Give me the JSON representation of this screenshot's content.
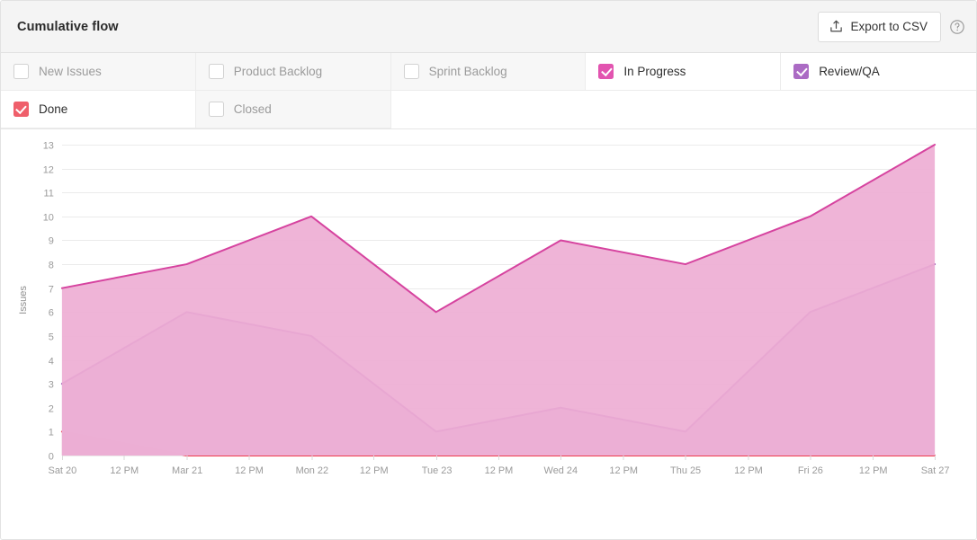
{
  "header": {
    "title": "Cumulative flow",
    "export_label": "Export to CSV",
    "export_icon": "upload-tray-icon",
    "help_icon": "help-circle-icon"
  },
  "legend": {
    "items": [
      {
        "label": "New Issues",
        "checked": false,
        "color": "#b6b6b6"
      },
      {
        "label": "Product Backlog",
        "checked": false,
        "color": "#b6b6b6"
      },
      {
        "label": "Sprint Backlog",
        "checked": false,
        "color": "#b6b6b6"
      },
      {
        "label": "In Progress",
        "checked": true,
        "color": "#e254b0"
      },
      {
        "label": "Review/QA",
        "checked": true,
        "color": "#ab6bc4"
      },
      {
        "label": "Done",
        "checked": true,
        "color": "#ef5f6b"
      },
      {
        "label": "Closed",
        "checked": false,
        "color": "#b6b6b6"
      }
    ]
  },
  "chart_data": {
    "type": "area",
    "title": "Cumulative flow",
    "xlabel": "",
    "ylabel": "Issues",
    "ylim": [
      0,
      13
    ],
    "yticks": [
      0,
      1,
      2,
      3,
      4,
      5,
      6,
      7,
      8,
      9,
      10,
      11,
      12,
      13
    ],
    "grid": true,
    "legend_position": "top",
    "x": [
      "Sat 20",
      "Mar 21",
      "Mon 22",
      "Tue 23",
      "Wed 24",
      "Thu 25",
      "Fri 26",
      "Sat 27"
    ],
    "xtick_labels": [
      "Sat 20",
      "12 PM",
      "Mar 21",
      "12 PM",
      "Mon 22",
      "12 PM",
      "Tue 23",
      "12 PM",
      "Wed 24",
      "12 PM",
      "Thu 25",
      "12 PM",
      "Fri 26",
      "12 PM",
      "Sat 27"
    ],
    "series": [
      {
        "name": "In Progress",
        "color": "#d6439f",
        "fill": "#eeaed4",
        "values": [
          7,
          8,
          10,
          6,
          9,
          8,
          10,
          13
        ]
      },
      {
        "name": "Review/QA",
        "color": "#a05bb8",
        "fill": "#d6b6db",
        "values": [
          3,
          6,
          5,
          1,
          2,
          1,
          6,
          8
        ]
      },
      {
        "name": "Done",
        "color": "#ef3c4e",
        "fill": "#f6adad",
        "values": [
          1,
          0,
          0,
          0,
          0,
          0,
          0,
          0
        ]
      }
    ]
  }
}
